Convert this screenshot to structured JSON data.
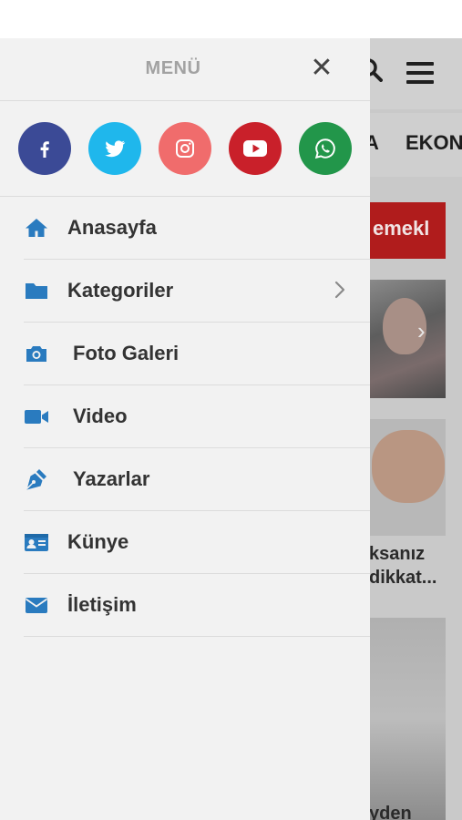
{
  "background_page": {
    "category_partial_1": "A",
    "category_partial_2": "EKONO",
    "breaking_partial": "emekl",
    "headline_partial_1": "ksanız",
    "headline_partial_2": "dikkat...",
    "headline_partial_3": "yden"
  },
  "menu": {
    "title": "MENÜ",
    "close_glyph": "✕",
    "social": [
      {
        "name": "facebook",
        "icon": "facebook-icon",
        "color": "#3b4a96"
      },
      {
        "name": "twitter",
        "icon": "twitter-icon",
        "color": "#1fb7ec"
      },
      {
        "name": "instagram",
        "icon": "instagram-icon",
        "color": "#f06c6c"
      },
      {
        "name": "youtube",
        "icon": "youtube-icon",
        "color": "#c9202a"
      },
      {
        "name": "whatsapp",
        "icon": "whatsapp-icon",
        "color": "#22964a"
      }
    ],
    "items": [
      {
        "label": "Anasayfa",
        "icon": "home-icon"
      },
      {
        "label": "Kategoriler",
        "icon": "folder-icon",
        "has_submenu": true
      },
      {
        "label": "Foto Galeri",
        "icon": "camera-icon"
      },
      {
        "label": "Video",
        "icon": "video-camera-icon"
      },
      {
        "label": "Yazarlar",
        "icon": "pen-nib-icon"
      },
      {
        "label": "Künye",
        "icon": "id-card-icon"
      },
      {
        "label": "İletişim",
        "icon": "envelope-icon"
      }
    ]
  },
  "colors": {
    "menu_icon_blue": "#2a7bbf",
    "menu_text": "#333333",
    "breaking_red": "#b01c1c"
  }
}
